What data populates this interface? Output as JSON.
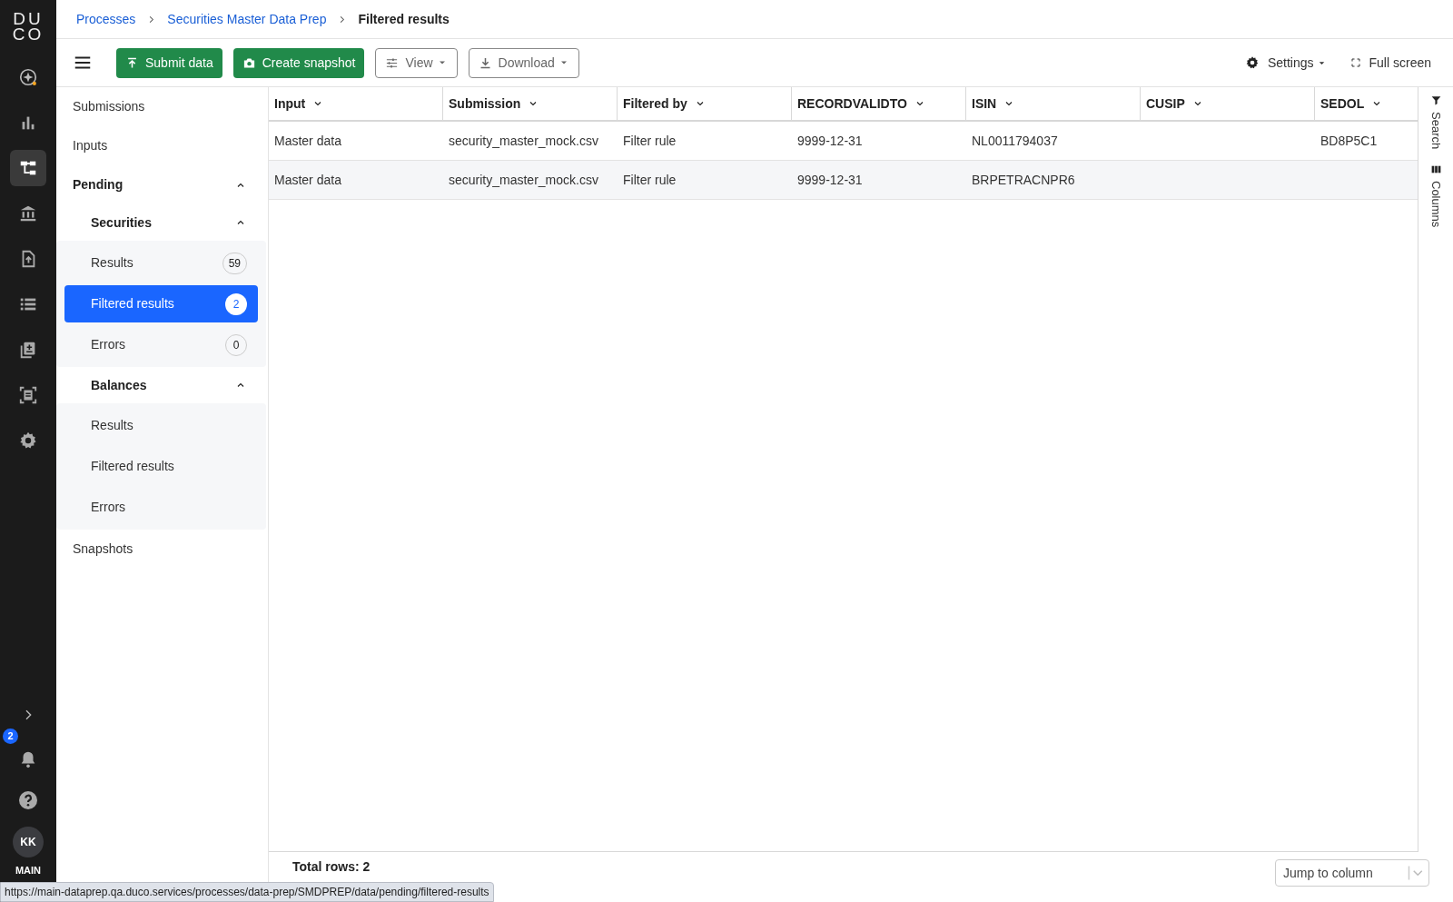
{
  "rail": {
    "logo": [
      "DU",
      "CO"
    ],
    "items": [
      {
        "kind": "sparkle",
        "selected": false
      },
      {
        "kind": "chart",
        "selected": false
      },
      {
        "kind": "hierarchy",
        "selected": true
      },
      {
        "kind": "bank",
        "selected": false
      },
      {
        "kind": "upload",
        "selected": false
      },
      {
        "kind": "list",
        "selected": false
      },
      {
        "kind": "clipboard",
        "selected": false
      },
      {
        "kind": "scan",
        "selected": false
      },
      {
        "kind": "gear",
        "selected": false
      }
    ],
    "notifications": "2",
    "avatar": "KK",
    "environment": "MAIN"
  },
  "breadcrumbs": [
    {
      "label": "Processes",
      "current": false
    },
    {
      "label": "Securities Master Data Prep",
      "current": false
    },
    {
      "label": "Filtered results",
      "current": true
    }
  ],
  "toolbar": {
    "buttons": [
      {
        "kind": "submit",
        "label": "Submit data"
      },
      {
        "kind": "snapshot",
        "label": "Create snapshot"
      },
      {
        "kind": "view",
        "label": "View"
      },
      {
        "kind": "download",
        "label": "Download"
      }
    ],
    "settings": "Settings",
    "fullscreen": "Full screen"
  },
  "sidebar": {
    "items": [
      {
        "label": "Submissions",
        "selected": false
      },
      {
        "label": "Inputs",
        "selected": false
      },
      {
        "label": "Pending",
        "expanded": true,
        "children": [
          {
            "label": "Securities",
            "expanded": true,
            "children": [
              {
                "label": "Results",
                "count": "59",
                "selected": false
              },
              {
                "label": "Filtered results",
                "count": "2",
                "selected": true
              },
              {
                "label": "Errors",
                "count": "0",
                "selected": false
              }
            ]
          },
          {
            "label": "Balances",
            "expanded": true,
            "children": [
              {
                "label": "Results",
                "selected": false
              },
              {
                "label": "Filtered results",
                "selected": false
              },
              {
                "label": "Errors",
                "selected": false
              }
            ]
          }
        ]
      },
      {
        "label": "Snapshots",
        "selected": false
      }
    ]
  },
  "table": {
    "columns": [
      "Input",
      "Submission",
      "Filtered by",
      "RECORDVALIDTO",
      "ISIN",
      "CUSIP",
      "SEDOL"
    ],
    "rows": [
      {
        "cells": [
          "Master data",
          "security_master_mock.csv",
          "Filter rule",
          "9999-12-31",
          "NL0011794037",
          null,
          "BD8P5C1"
        ]
      },
      {
        "cells": [
          "Master data",
          "security_master_mock.csv",
          "Filter rule",
          "9999-12-31",
          "BRPETRACNPR6",
          null,
          null
        ]
      }
    ]
  },
  "side_panel": {
    "tabs": [
      {
        "kind": "filter",
        "label": "Search"
      },
      {
        "kind": "columns",
        "label": "Columns"
      }
    ]
  },
  "footer": {
    "total": "Total rows: 2",
    "jump_placeholder": "Jump to column"
  },
  "status_url": "https://main-dataprep.qa.duco.services/processes/data-prep/SMDPREP/data/pending/filtered-results"
}
